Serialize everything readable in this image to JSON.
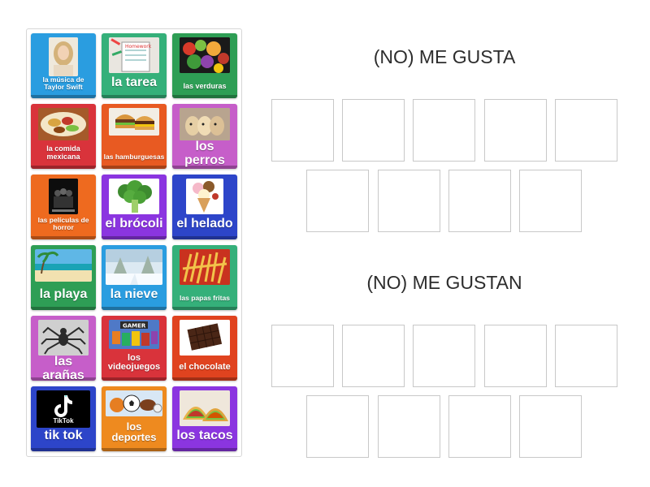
{
  "groups": [
    {
      "heading": "(NO) ME GUSTA"
    },
    {
      "heading": "(NO) ME GUSTAN"
    }
  ],
  "cards": [
    {
      "label": "la música de Taylor Swift",
      "color": "#2a9de0",
      "icon": "singer-portrait-icon"
    },
    {
      "label": "la tarea",
      "color": "#35b07a",
      "icon": "homework-icon"
    },
    {
      "label": "las verduras",
      "color": "#2e9e55",
      "icon": "vegetables-icon"
    },
    {
      "label": "la comida mexicana",
      "color": "#d9333b",
      "icon": "mexican-food-icon"
    },
    {
      "label": "las hamburguesas",
      "color": "#e85a22",
      "icon": "burger-icon"
    },
    {
      "label": "los perros",
      "color": "#c65ec9",
      "icon": "puppies-icon"
    },
    {
      "label": "las películas de horror",
      "color": "#ee6a1f",
      "icon": "horror-movie-icon"
    },
    {
      "label": "el brócoli",
      "color": "#8b35e0",
      "icon": "broccoli-icon"
    },
    {
      "label": "el helado",
      "color": "#2d45c9",
      "icon": "ice-cream-icon"
    },
    {
      "label": "la playa",
      "color": "#2e9e55",
      "icon": "beach-icon"
    },
    {
      "label": "la nieve",
      "color": "#2a9de0",
      "icon": "snow-icon"
    },
    {
      "label": "las papas fritas",
      "color": "#35b07a",
      "icon": "fries-icon"
    },
    {
      "label": "las arañas",
      "color": "#c65ec9",
      "icon": "spider-icon"
    },
    {
      "label": "los videojuegos",
      "color": "#d9333b",
      "icon": "video-games-icon"
    },
    {
      "label": "el chocolate",
      "color": "#e0431f",
      "icon": "chocolate-icon"
    },
    {
      "label": "tik tok",
      "color": "#2d45c9",
      "icon": "tiktok-icon",
      "logo_text": "TikTok"
    },
    {
      "label": "los deportes",
      "color": "#ee8a1f",
      "icon": "sports-balls-icon"
    },
    {
      "label": "los tacos",
      "color": "#8b35e0",
      "icon": "tacos-icon"
    }
  ]
}
